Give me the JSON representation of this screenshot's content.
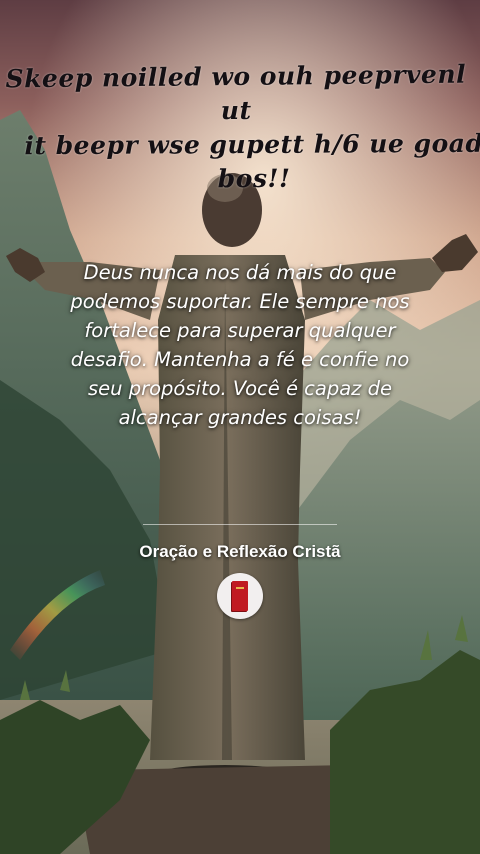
{
  "image": {
    "overlay_text": {
      "line1": "Skeep noilled wo ouh peeprvenl ut",
      "line2": "it beepr wse gupett h/6 ue goad bos!!"
    },
    "quote": {
      "line1": "Deus nunca nos dá mais do que",
      "line2": "podemos suportar. Ele sempre nos",
      "line3": "fortalece para superar qualquer",
      "line4": "desafio. Mantenha a fé e confie no",
      "line5": "seu propósito. Você é capaz de",
      "line6": "alcançar grandes coisas!"
    },
    "channel": {
      "title": "Oração e Reflexão Cristã",
      "avatar_icon": "red-bible-icon"
    }
  },
  "colors": {
    "sky_top": "#6e4a4a",
    "sky_glow": "#e9c0a0",
    "mountain": "#4f6a5e",
    "foreground": "#2a3a22",
    "robe": "#6f6454",
    "text": "#ffffff",
    "book": "#c01a22"
  }
}
